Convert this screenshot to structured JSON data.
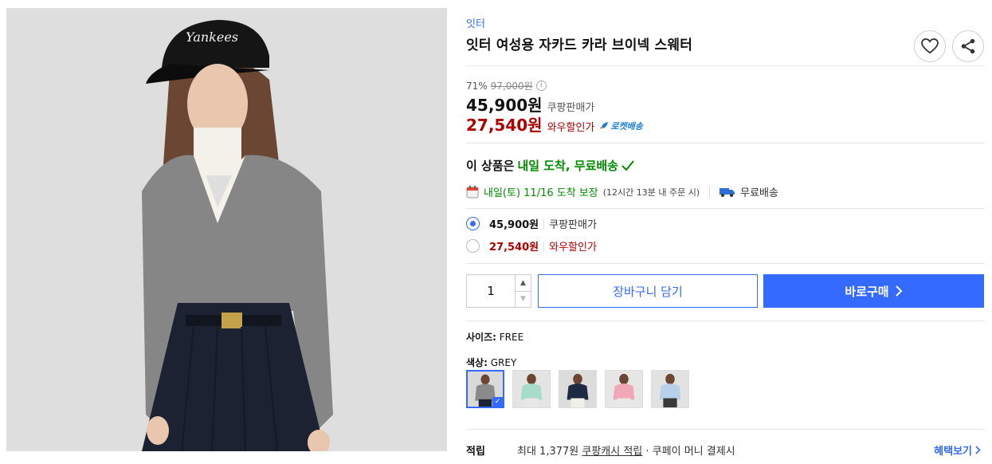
{
  "product": {
    "brand": "잇터",
    "title": "잇터 여성용 자카드 카라 브이넥 스웨터"
  },
  "price": {
    "discount_rate": "71%",
    "original_price": "97,000원",
    "sale_price": "45,900원",
    "sale_label": "쿠팡판매가",
    "wow_price": "27,540원",
    "wow_label": "와우할인가",
    "rocket_label": "로켓배송"
  },
  "delivery": {
    "headline_prefix": "이 상품은",
    "headline_highlight": "내일 도착, 무료배송",
    "arrival_date": "내일(토) 11/16 도착 보장",
    "cutoff_note": "(12시간 13분 내 주문 시)",
    "free_shipping": "무료배송"
  },
  "options": [
    {
      "price": "45,900원",
      "label": "쿠팡판매가",
      "selected": true
    },
    {
      "price": "27,540원",
      "label": "와우할인가",
      "selected": false
    }
  ],
  "purchase": {
    "quantity": "1",
    "cart_label": "장바구니 담기",
    "buy_label": "바로구매"
  },
  "size": {
    "label": "사이즈:",
    "value": "FREE"
  },
  "color": {
    "label": "색상:",
    "value": "GREY",
    "swatches": [
      {
        "name": "grey",
        "hex": "#8a8a8a",
        "selected": true
      },
      {
        "name": "mint",
        "hex": "#a8dcc8",
        "selected": false
      },
      {
        "name": "navy",
        "hex": "#1e2a44",
        "selected": false
      },
      {
        "name": "pink",
        "hex": "#f0a8b8",
        "selected": false
      },
      {
        "name": "sky",
        "hex": "#b8d0ea",
        "selected": false
      }
    ]
  },
  "points": {
    "label": "적립",
    "text_prefix": "최대 1,377원",
    "text_link": "쿠팡캐시 적립",
    "text_suffix": "· 쿠페이 머니 결제시",
    "benefits_link": "혜택보기"
  },
  "colors": {
    "accent": "#346aff",
    "wow_red": "#ae0000",
    "green": "#008c00"
  }
}
